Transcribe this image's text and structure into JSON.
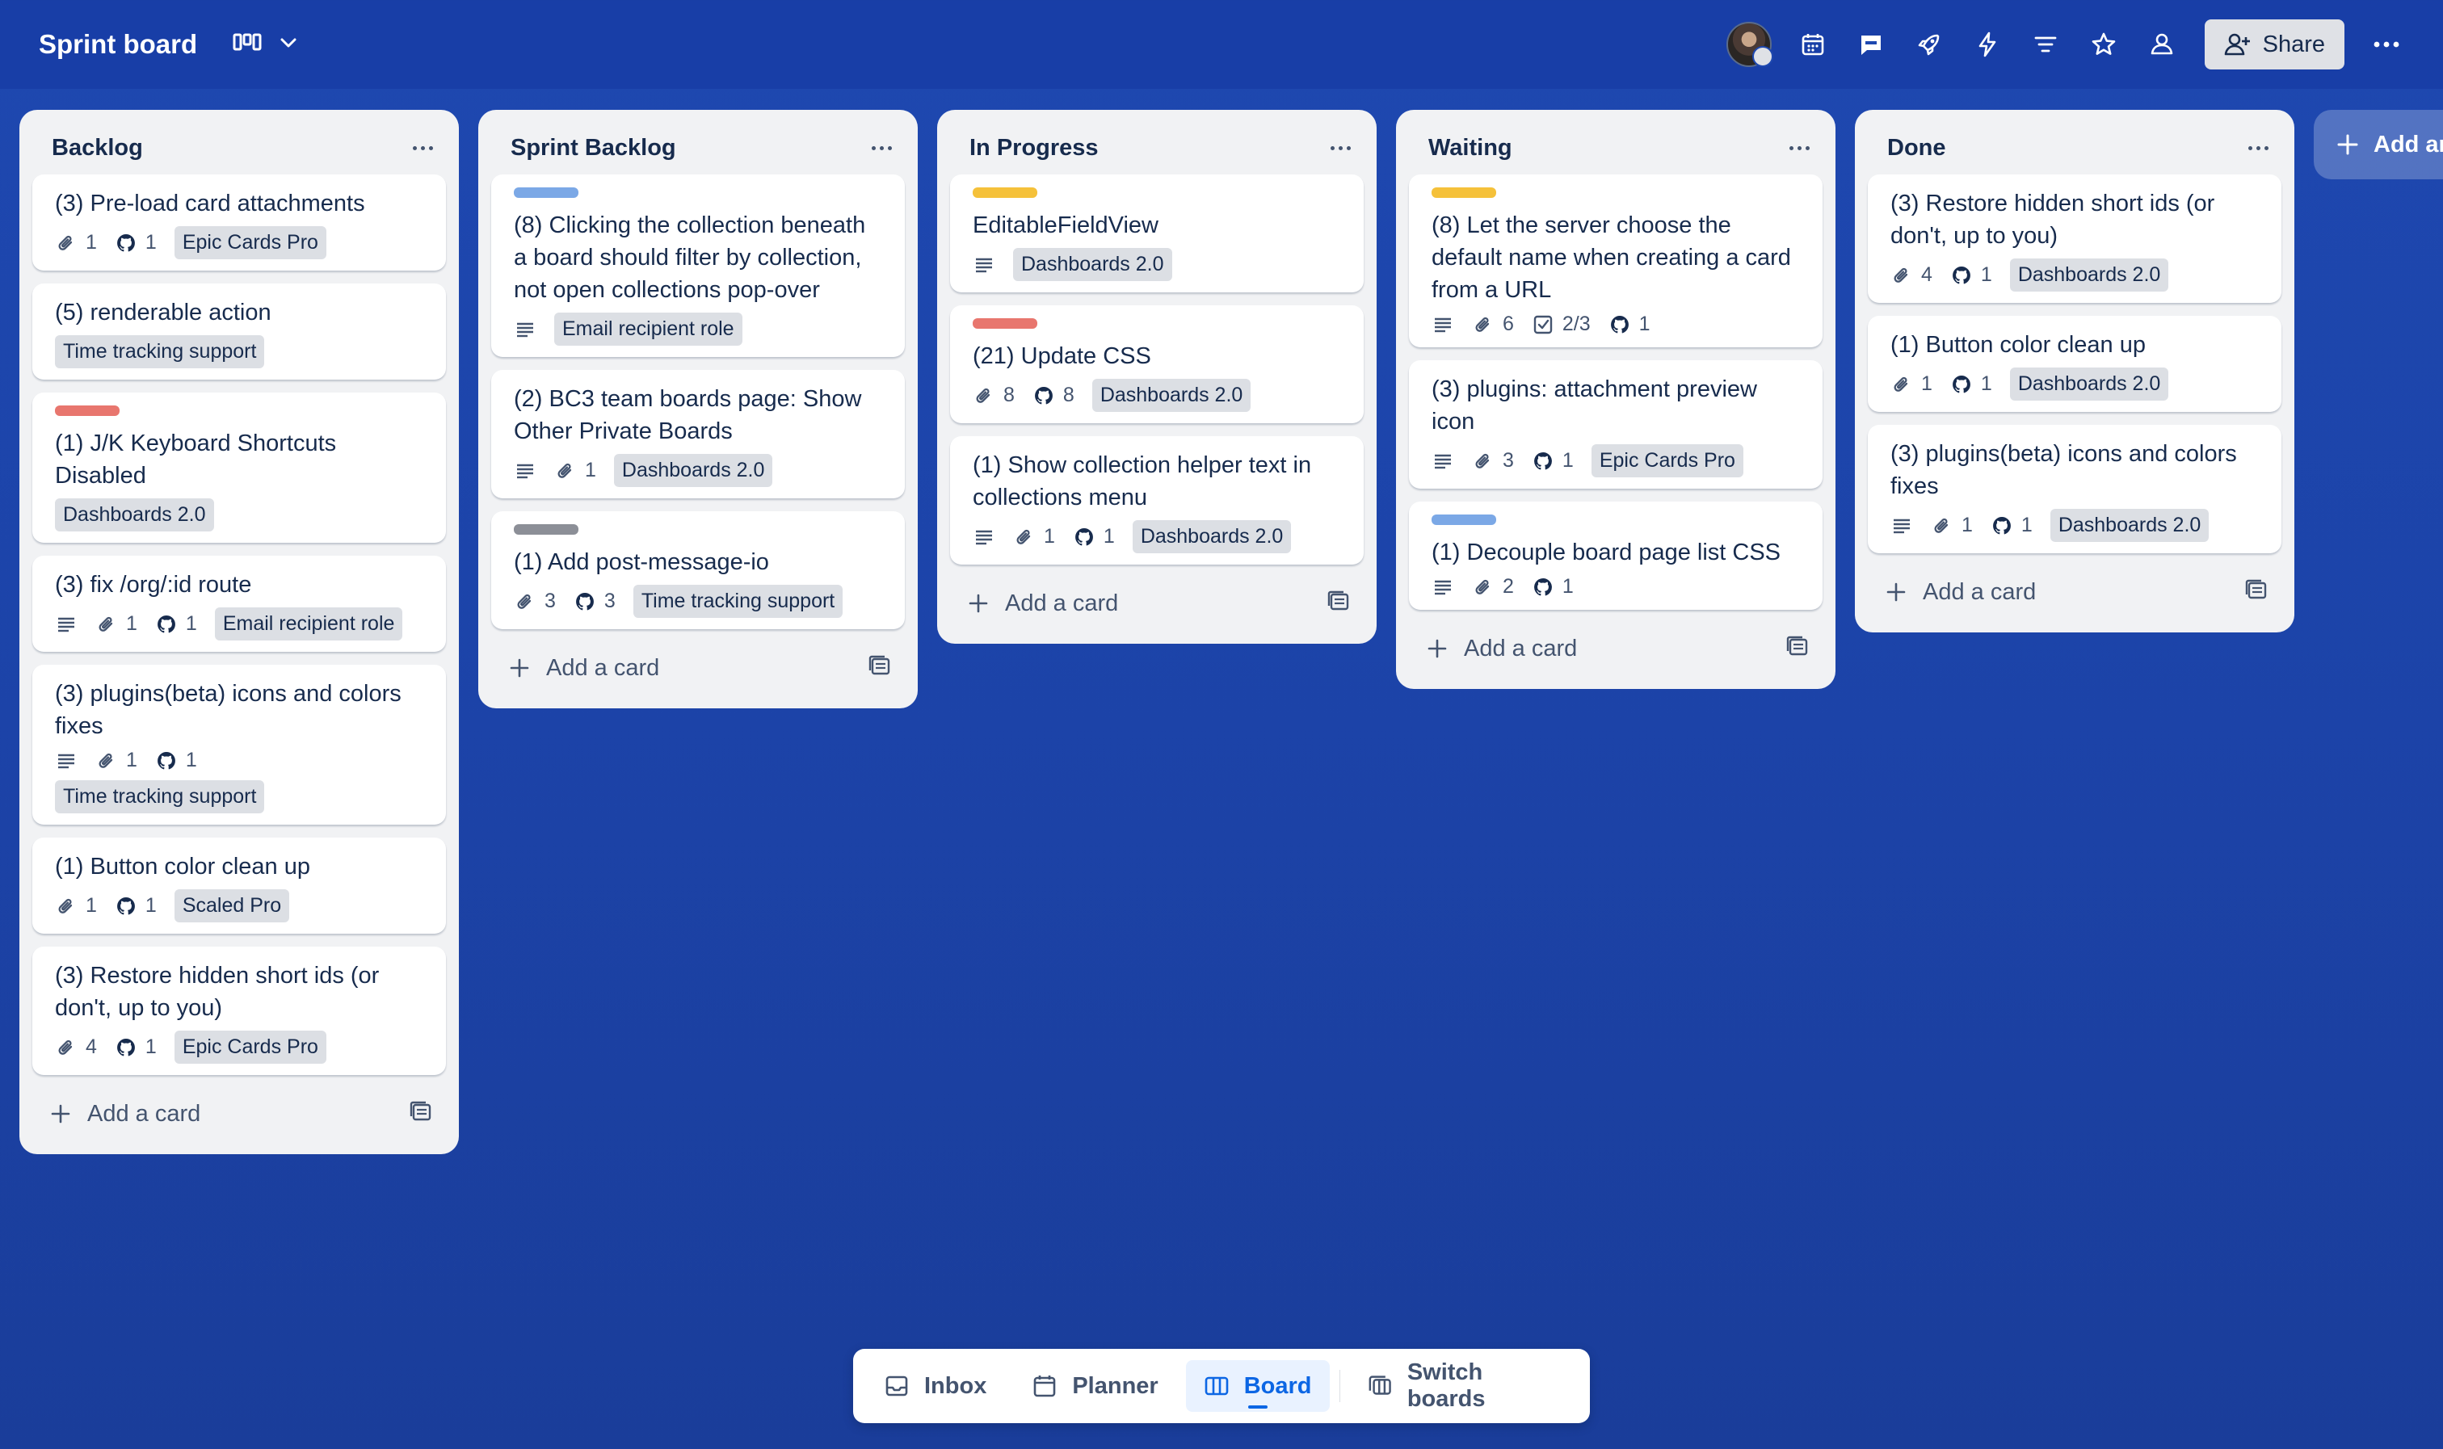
{
  "header": {
    "title": "Sprint board",
    "share_label": "Share",
    "icons": [
      "avatar",
      "calendar-icon",
      "scaled-pro-icon",
      "rocket-icon",
      "lightning-icon",
      "filter-icon",
      "star-icon",
      "team-icon",
      "more-icon"
    ]
  },
  "colors": {
    "label_blue": "#7ba8e6",
    "label_yellow": "#f5c13a",
    "label_red": "#e8766e",
    "label_gray": "#8c8f97"
  },
  "lists": [
    {
      "title": "Backlog",
      "add_label": "Add a card",
      "cards": [
        {
          "title": "(3) Pre-load card attachments",
          "attachments": "1",
          "github": "1",
          "tag": "Epic Cards Pro"
        },
        {
          "title": "(5) renderable action",
          "tag": "Time tracking support"
        },
        {
          "label": "red",
          "title": "(1) J/K Keyboard Shortcuts Disabled",
          "tag": "Dashboards 2.0"
        },
        {
          "title": "(3) fix /org/:id route",
          "description": true,
          "attachments": "1",
          "github": "1",
          "tag": "Email recipient role"
        },
        {
          "title": "(3) plugins(beta) icons and colors fixes",
          "description": true,
          "attachments": "1",
          "github": "1",
          "tag": "Time tracking support"
        },
        {
          "title": "(1) Button color clean up",
          "attachments": "1",
          "github": "1",
          "tag": "Scaled Pro"
        },
        {
          "title": "(3) Restore hidden short ids (or don't, up to you)",
          "attachments": "4",
          "github": "1",
          "tag": "Epic Cards Pro"
        }
      ]
    },
    {
      "title": "Sprint Backlog",
      "add_label": "Add a card",
      "cards": [
        {
          "label": "blue",
          "title": "(8) Clicking the collection beneath a board should filter by collection, not open collections pop-over",
          "description": true,
          "tag": "Email recipient role"
        },
        {
          "title": "(2) BC3 team boards page: Show Other Private Boards",
          "description": true,
          "attachments": "1",
          "tag": "Dashboards 2.0"
        },
        {
          "label": "gray",
          "title": "(1) Add post-message-io",
          "attachments": "3",
          "github": "3",
          "tag": "Time tracking support"
        }
      ]
    },
    {
      "title": "In Progress",
      "add_label": "Add a card",
      "cards": [
        {
          "label": "yellow",
          "title": "EditableFieldView",
          "description": true,
          "tag": "Dashboards 2.0"
        },
        {
          "label": "red",
          "title": "(21) Update CSS",
          "attachments": "8",
          "github": "8",
          "tag": "Dashboards 2.0"
        },
        {
          "title": "(1) Show collection helper text in collections menu",
          "description": true,
          "attachments": "1",
          "github": "1",
          "tag": "Dashboards 2.0"
        }
      ]
    },
    {
      "title": "Waiting",
      "add_label": "Add a card",
      "cards": [
        {
          "label": "yellow",
          "title": "(8) Let the server choose the default name when creating a card from a URL",
          "description": true,
          "attachments": "6",
          "checklist": "2/3",
          "github": "1"
        },
        {
          "title": "(3) plugins: attachment preview icon",
          "description": true,
          "attachments": "3",
          "github": "1",
          "tag": "Epic Cards Pro"
        },
        {
          "label": "blue",
          "title": "(1) Decouple board page list CSS",
          "description": true,
          "attachments": "2",
          "github": "1"
        }
      ]
    },
    {
      "title": "Done",
      "add_label": "Add a card",
      "cards": [
        {
          "title": "(3) Restore hidden short ids (or don't, up to you)",
          "attachments": "4",
          "github": "1",
          "tag": "Dashboards 2.0"
        },
        {
          "title": "(1) Button color clean up",
          "attachments": "1",
          "github": "1",
          "tag": "Dashboards 2.0"
        },
        {
          "title": "(3) plugins(beta) icons and colors fixes",
          "description": true,
          "attachments": "1",
          "github": "1",
          "tag": "Dashboards 2.0"
        }
      ]
    }
  ],
  "add_list_label": "Add another list",
  "bottom_nav": {
    "inbox": "Inbox",
    "planner": "Planner",
    "board": "Board",
    "switch": "Switch boards"
  }
}
